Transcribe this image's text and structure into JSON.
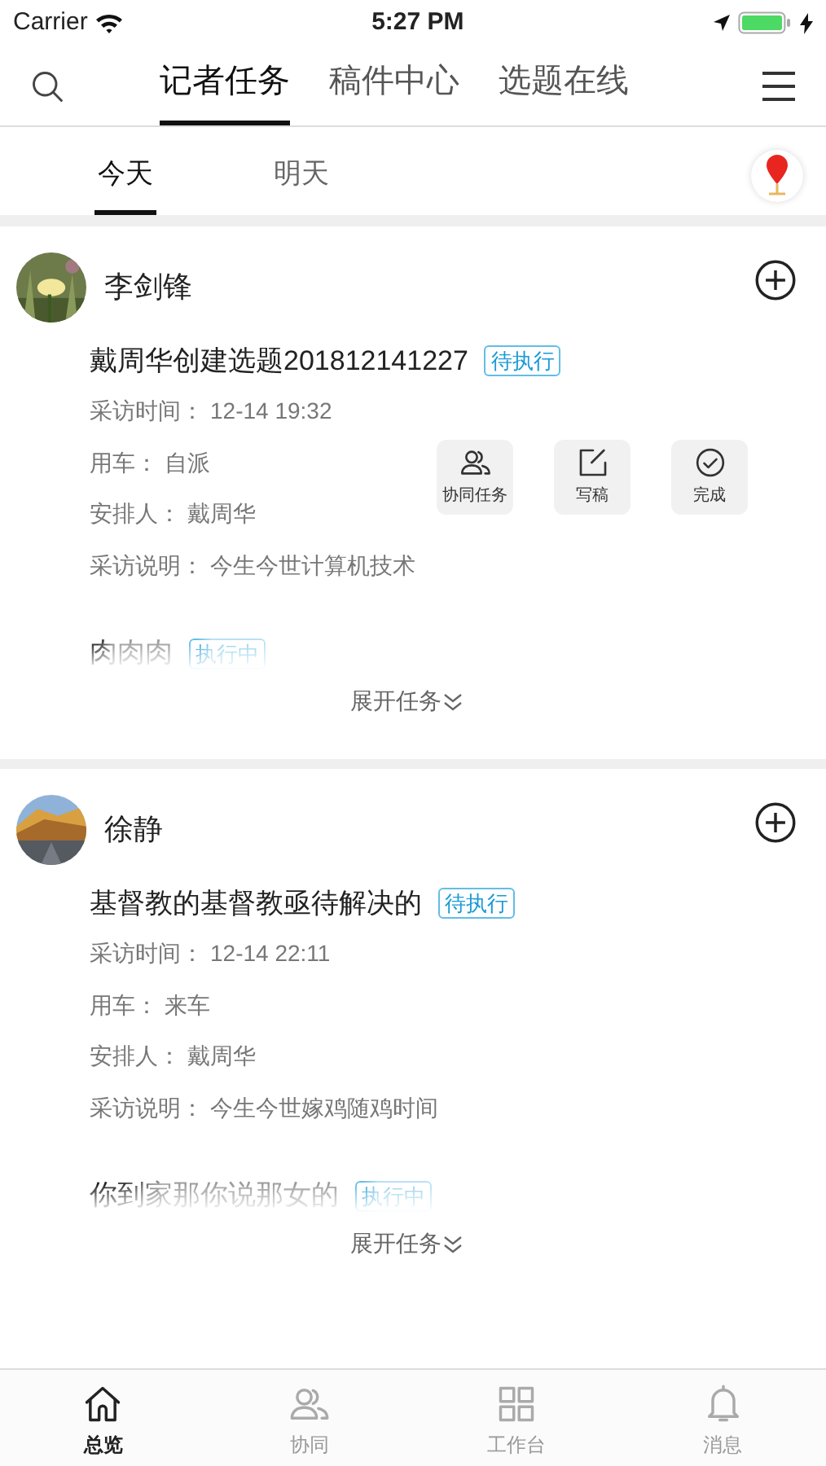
{
  "status_bar": {
    "carrier": "Carrier",
    "time": "5:27 PM"
  },
  "top_tabs": [
    {
      "label": "记者任务",
      "selected": true
    },
    {
      "label": "稿件中心",
      "selected": false
    },
    {
      "label": "选题在线",
      "selected": false
    }
  ],
  "sub_tabs": [
    {
      "label": "今天",
      "selected": true
    },
    {
      "label": "明天",
      "selected": false
    }
  ],
  "cards": [
    {
      "name": "李剑锋",
      "tasks": [
        {
          "title": "戴周华创建选题201812141227",
          "status": "待执行",
          "collapsed": false,
          "fields": [
            {
              "label": "采访时间：",
              "value": "12-14 19:32"
            },
            {
              "label": "用车：",
              "value": "自派"
            },
            {
              "label": "安排人：",
              "value": "戴周华"
            },
            {
              "label": "采访说明：",
              "value": "今生今世计算机技术"
            }
          ],
          "actions": [
            {
              "kind": "team",
              "label": "协同任务"
            },
            {
              "kind": "write",
              "label": "写稿"
            },
            {
              "kind": "done",
              "label": "完成"
            }
          ]
        },
        {
          "title": "肉肉肉",
          "status": "执行中",
          "collapsed": true
        }
      ],
      "expand": "展开任务"
    },
    {
      "name": "徐静",
      "tasks": [
        {
          "title": "基督教的基督教亟待解决的",
          "status": "待执行",
          "collapsed": false,
          "fields": [
            {
              "label": "采访时间：",
              "value": "12-14 22:11"
            },
            {
              "label": "用车：",
              "value": "来车"
            },
            {
              "label": "安排人：",
              "value": "戴周华"
            },
            {
              "label": "采访说明：",
              "value": "今生今世嫁鸡随鸡时间"
            }
          ]
        },
        {
          "title": "你到家那你说那女的",
          "status": "执行中",
          "collapsed": true
        }
      ],
      "expand": "展开任务"
    }
  ],
  "bottom_tabs": [
    {
      "kind": "home",
      "label": "总览",
      "selected": true
    },
    {
      "kind": "team",
      "label": "协同",
      "selected": false
    },
    {
      "kind": "grid",
      "label": "工作台",
      "selected": false
    },
    {
      "kind": "bell",
      "label": "消息",
      "selected": false
    }
  ]
}
